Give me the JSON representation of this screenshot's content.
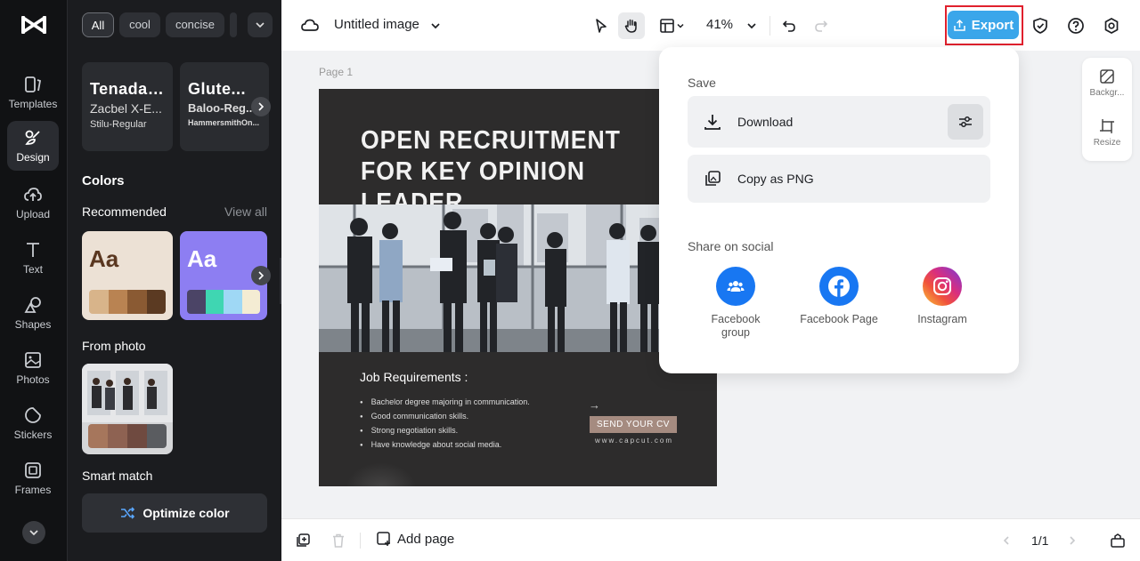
{
  "rail": {
    "items": [
      {
        "label": "Templates"
      },
      {
        "label": "Design"
      },
      {
        "label": "Upload"
      },
      {
        "label": "Text"
      },
      {
        "label": "Shapes"
      },
      {
        "label": "Photos"
      },
      {
        "label": "Stickers"
      },
      {
        "label": "Frames"
      }
    ],
    "active": "Design"
  },
  "panel": {
    "chips": [
      "All",
      "cool",
      "concise"
    ],
    "fonts": [
      {
        "line1": "Tenada-...",
        "line2": "Zacbel X-E...",
        "line3": "Stilu-Regular"
      },
      {
        "line1": "Glute...",
        "line2": "Baloo-Reg...",
        "line3": "HammersmithOn..."
      }
    ],
    "colors_title": "Colors",
    "recommended_label": "Recommended",
    "view_all": "View all",
    "palettes": [
      {
        "sample": "Aa",
        "bg": "#ece1d5",
        "text_color": "#5a3720",
        "swatches": [
          "#d8b48a",
          "#b98352",
          "#8a5a33",
          "#5b3a22"
        ]
      },
      {
        "sample": "Aa",
        "bg": "#8d7ef2",
        "text_color": "#ffffff",
        "swatches": [
          "#4b4466",
          "#3fd6b2",
          "#9fd8f5",
          "#f4ecd3"
        ]
      }
    ],
    "from_photo_label": "From photo",
    "photo_swatches": [
      "#a6765c",
      "#8e6252",
      "#6f4a40",
      "#5a5c60"
    ],
    "smart_match_label": "Smart match",
    "optimize_label": "Optimize color"
  },
  "topbar": {
    "title": "Untitled image",
    "zoom": "41%",
    "export_label": "Export",
    "accent": "#3aa6ea"
  },
  "canvas": {
    "page_label": "Page 1",
    "design": {
      "headline": "OPEN RECRUITMENT FOR KEY OPINION LEADER",
      "section_title": "Job Requirements :",
      "requirements": [
        "Bachelor degree majoring in communication.",
        "Good communication skills.",
        "Strong negotiation skills.",
        "Have knowledge about social media."
      ],
      "arrow": "→",
      "cta": "SEND YOUR CV",
      "url": "www.capcut.com"
    }
  },
  "right_tools": {
    "items": [
      {
        "label": "Backgr..."
      },
      {
        "label": "Resize"
      }
    ]
  },
  "bottombar": {
    "add_page": "Add page",
    "pager": "1/1"
  },
  "export_popup": {
    "save_label": "Save",
    "download_label": "Download",
    "copy_label": "Copy as PNG",
    "share_label": "Share on social",
    "socials": [
      {
        "label": "Facebook group",
        "color": "#1877f2"
      },
      {
        "label": "Facebook Page",
        "color": "#1877f2"
      },
      {
        "label": "Instagram",
        "color": "#e1306c"
      }
    ]
  }
}
